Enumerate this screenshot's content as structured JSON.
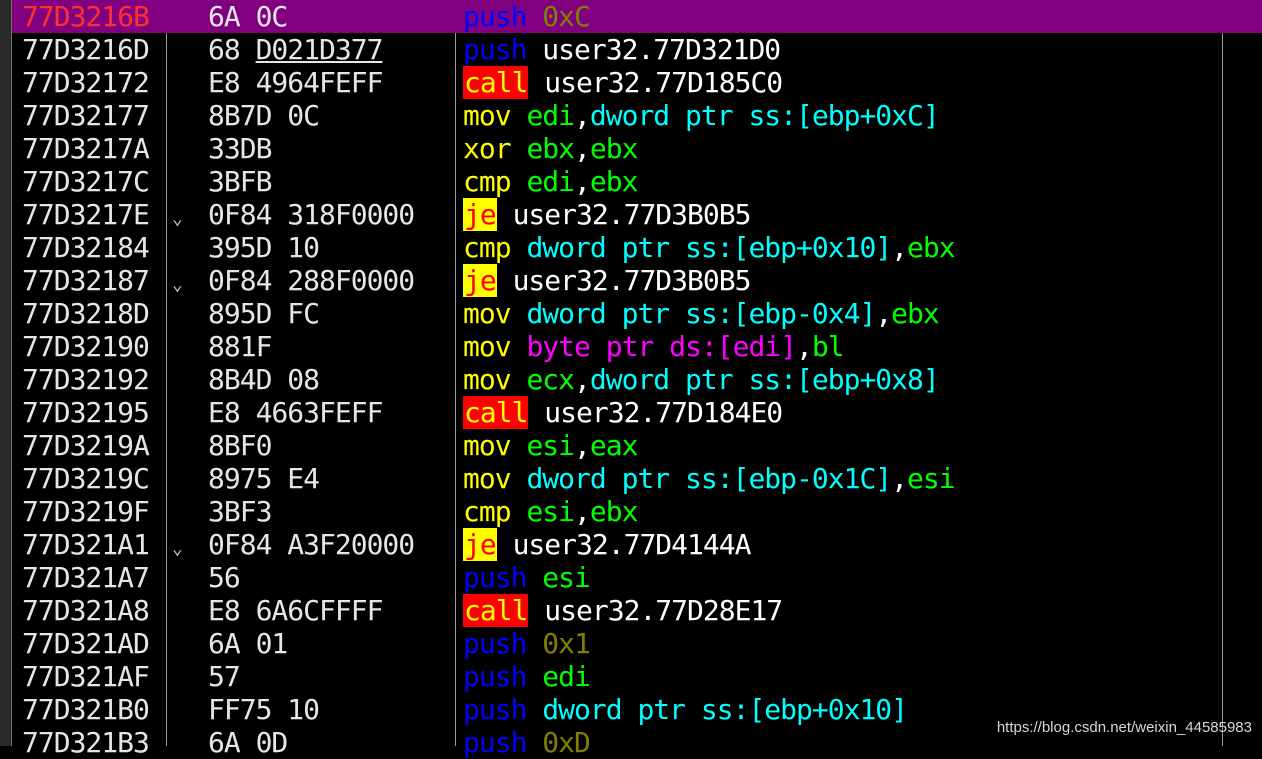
{
  "colors": {
    "background": "#000000",
    "selected_row": "#800080",
    "selected_addr": "#ff3030",
    "push": "#0000ff",
    "call_bg": "#ff0000",
    "call_fg": "#ffff00",
    "je_bg": "#ffff00",
    "je_fg": "#ff0000",
    "mov_xor_cmp": "#ffff00",
    "immediate": "#808000",
    "label": "#ffffff",
    "register": "#00ff00",
    "memory_dword": "#00ffff",
    "memory_byte": "#ff00ff"
  },
  "rows": [
    {
      "addr": "77D3216B",
      "bytes": "6A 0C",
      "mnemonic": "push",
      "operands": [
        {
          "text": "0xC",
          "kind": "imm"
        }
      ],
      "selected": true
    },
    {
      "addr": "77D3216D",
      "bytes": "68",
      "bytes_ul": "D021D377",
      "mnemonic": "push",
      "operands": [
        {
          "text": "user32.77D321D0",
          "kind": "lbl"
        }
      ]
    },
    {
      "addr": "77D32172",
      "bytes": "E8 4964FEFF",
      "mnemonic": "call",
      "operands": [
        {
          "text": "user32.77D185C0",
          "kind": "lbl"
        }
      ]
    },
    {
      "addr": "77D32177",
      "bytes": "8B7D 0C",
      "mnemonic": "mov",
      "operands": [
        {
          "text": "edi",
          "kind": "reg"
        },
        {
          "text": ",",
          "kind": "comma"
        },
        {
          "text": "dword ptr ss:[ebp+0xC]",
          "kind": "mem"
        }
      ]
    },
    {
      "addr": "77D3217A",
      "bytes": "33DB",
      "mnemonic": "xor",
      "operands": [
        {
          "text": "ebx",
          "kind": "reg"
        },
        {
          "text": ",",
          "kind": "comma"
        },
        {
          "text": "ebx",
          "kind": "reg"
        }
      ]
    },
    {
      "addr": "77D3217C",
      "bytes": "3BFB",
      "mnemonic": "cmp",
      "operands": [
        {
          "text": "edi",
          "kind": "reg"
        },
        {
          "text": ",",
          "kind": "comma"
        },
        {
          "text": "ebx",
          "kind": "reg"
        }
      ]
    },
    {
      "addr": "77D3217E",
      "arrow": "⌄",
      "bytes": "0F84 318F0000",
      "mnemonic": "je",
      "operands": [
        {
          "text": "user32.77D3B0B5",
          "kind": "lbl"
        }
      ]
    },
    {
      "addr": "77D32184",
      "bytes": "395D 10",
      "mnemonic": "cmp",
      "operands": [
        {
          "text": "dword ptr ss:[ebp+0x10]",
          "kind": "mem"
        },
        {
          "text": ",",
          "kind": "comma"
        },
        {
          "text": "ebx",
          "kind": "reg"
        }
      ]
    },
    {
      "addr": "77D32187",
      "arrow": "⌄",
      "bytes": "0F84 288F0000",
      "mnemonic": "je",
      "operands": [
        {
          "text": "user32.77D3B0B5",
          "kind": "lbl"
        }
      ]
    },
    {
      "addr": "77D3218D",
      "bytes": "895D FC",
      "mnemonic": "mov",
      "operands": [
        {
          "text": "dword ptr ss:[ebp-0x4]",
          "kind": "mem"
        },
        {
          "text": ",",
          "kind": "comma"
        },
        {
          "text": "ebx",
          "kind": "reg"
        }
      ]
    },
    {
      "addr": "77D32190",
      "bytes": "881F",
      "mnemonic": "mov",
      "operands": [
        {
          "text": "byte ptr ds:[edi]",
          "kind": "membyte"
        },
        {
          "text": ",",
          "kind": "comma"
        },
        {
          "text": "bl",
          "kind": "reg"
        }
      ]
    },
    {
      "addr": "77D32192",
      "bytes": "8B4D 08",
      "mnemonic": "mov",
      "operands": [
        {
          "text": "ecx",
          "kind": "reg"
        },
        {
          "text": ",",
          "kind": "comma"
        },
        {
          "text": "dword ptr ss:[ebp+0x8]",
          "kind": "mem"
        }
      ]
    },
    {
      "addr": "77D32195",
      "bytes": "E8 4663FEFF",
      "mnemonic": "call",
      "operands": [
        {
          "text": "user32.77D184E0",
          "kind": "lbl"
        }
      ]
    },
    {
      "addr": "77D3219A",
      "bytes": "8BF0",
      "mnemonic": "mov",
      "operands": [
        {
          "text": "esi",
          "kind": "reg"
        },
        {
          "text": ",",
          "kind": "comma"
        },
        {
          "text": "eax",
          "kind": "reg"
        }
      ]
    },
    {
      "addr": "77D3219C",
      "bytes": "8975 E4",
      "mnemonic": "mov",
      "operands": [
        {
          "text": "dword ptr ss:[ebp-0x1C]",
          "kind": "mem"
        },
        {
          "text": ",",
          "kind": "comma"
        },
        {
          "text": "esi",
          "kind": "reg"
        }
      ]
    },
    {
      "addr": "77D3219F",
      "bytes": "3BF3",
      "mnemonic": "cmp",
      "operands": [
        {
          "text": "esi",
          "kind": "reg"
        },
        {
          "text": ",",
          "kind": "comma"
        },
        {
          "text": "ebx",
          "kind": "reg"
        }
      ]
    },
    {
      "addr": "77D321A1",
      "arrow": "⌄",
      "bytes": "0F84 A3F20000",
      "mnemonic": "je",
      "operands": [
        {
          "text": "user32.77D4144A",
          "kind": "lbl"
        }
      ]
    },
    {
      "addr": "77D321A7",
      "bytes": "56",
      "mnemonic": "push",
      "operands": [
        {
          "text": "esi",
          "kind": "reg"
        }
      ]
    },
    {
      "addr": "77D321A8",
      "bytes": "E8 6A6CFFFF",
      "mnemonic": "call",
      "operands": [
        {
          "text": "user32.77D28E17",
          "kind": "lbl"
        }
      ]
    },
    {
      "addr": "77D321AD",
      "bytes": "6A 01",
      "mnemonic": "push",
      "operands": [
        {
          "text": "0x1",
          "kind": "imm"
        }
      ]
    },
    {
      "addr": "77D321AF",
      "bytes": "57",
      "mnemonic": "push",
      "operands": [
        {
          "text": "edi",
          "kind": "reg"
        }
      ]
    },
    {
      "addr": "77D321B0",
      "bytes": "FF75 10",
      "mnemonic": "push",
      "operands": [
        {
          "text": "dword ptr ss:[ebp+0x10]",
          "kind": "mem"
        }
      ]
    },
    {
      "addr": "77D321B3",
      "bytes": "6A 0D",
      "mnemonic": "push",
      "operands": [
        {
          "text": "0xD",
          "kind": "imm"
        }
      ]
    }
  ],
  "watermark": "https://blog.csdn.net/weixin_44585983"
}
